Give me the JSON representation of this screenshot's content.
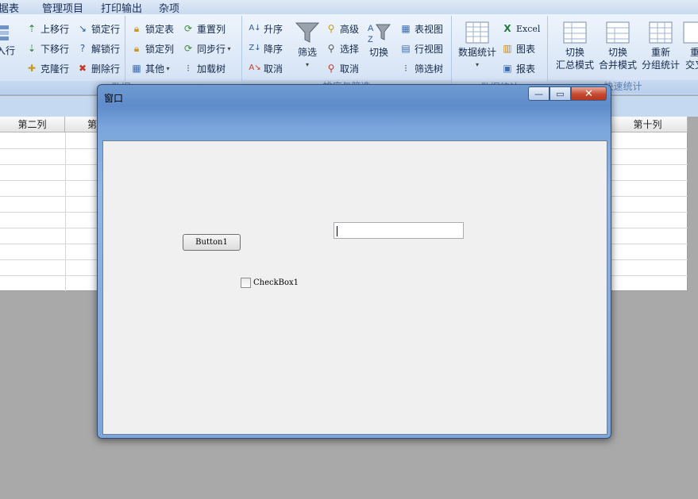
{
  "menu": {
    "items": [
      "数据表",
      "管理项目",
      "打印输出",
      "杂项"
    ],
    "visible_first_fragment": "据表"
  },
  "ribbon": {
    "group1": {
      "partial_left_label": "入行",
      "col1": [
        "上移行",
        "下移行",
        "克隆行"
      ],
      "col2": [
        "锁定行",
        "解锁行",
        "删除行"
      ],
      "footer": "数据"
    },
    "group2": {
      "col1": [
        "锁定表",
        "锁定列",
        "其他"
      ],
      "col2": [
        "重置列",
        "同步行",
        "加载树"
      ]
    },
    "group3": {
      "sort": [
        "升序",
        "降序",
        "取消"
      ],
      "filter_big": "筛选",
      "filter_small": [
        "高级",
        "选择",
        "取消"
      ],
      "switch_big": "切换",
      "views": [
        "表视图",
        "行视图",
        "筛选树"
      ],
      "footer": "排序与筛选"
    },
    "group4": {
      "big": "数据统计",
      "small": [
        "Excel",
        "图表",
        "报表"
      ],
      "footer": "数据统计"
    },
    "group5": {
      "buttons": [
        {
          "line1": "切换",
          "line2": "汇总模式"
        },
        {
          "line1": "切换",
          "line2": "合并模式"
        },
        {
          "line1": "重新",
          "line2": "分组统计"
        },
        {
          "line1": "重",
          "line2": "交叉"
        }
      ],
      "footer": "快速统计"
    }
  },
  "sheet": {
    "columns": [
      "第二列",
      "第",
      "第十列"
    ],
    "row_count": 10
  },
  "dialog": {
    "title": "窗口",
    "min_glyph": "—",
    "max_glyph": "▭",
    "close_glyph": "✕",
    "button1_label": "Button1",
    "textbox_value": "",
    "checkbox_label": "CheckBox1",
    "checkbox_checked": false
  }
}
